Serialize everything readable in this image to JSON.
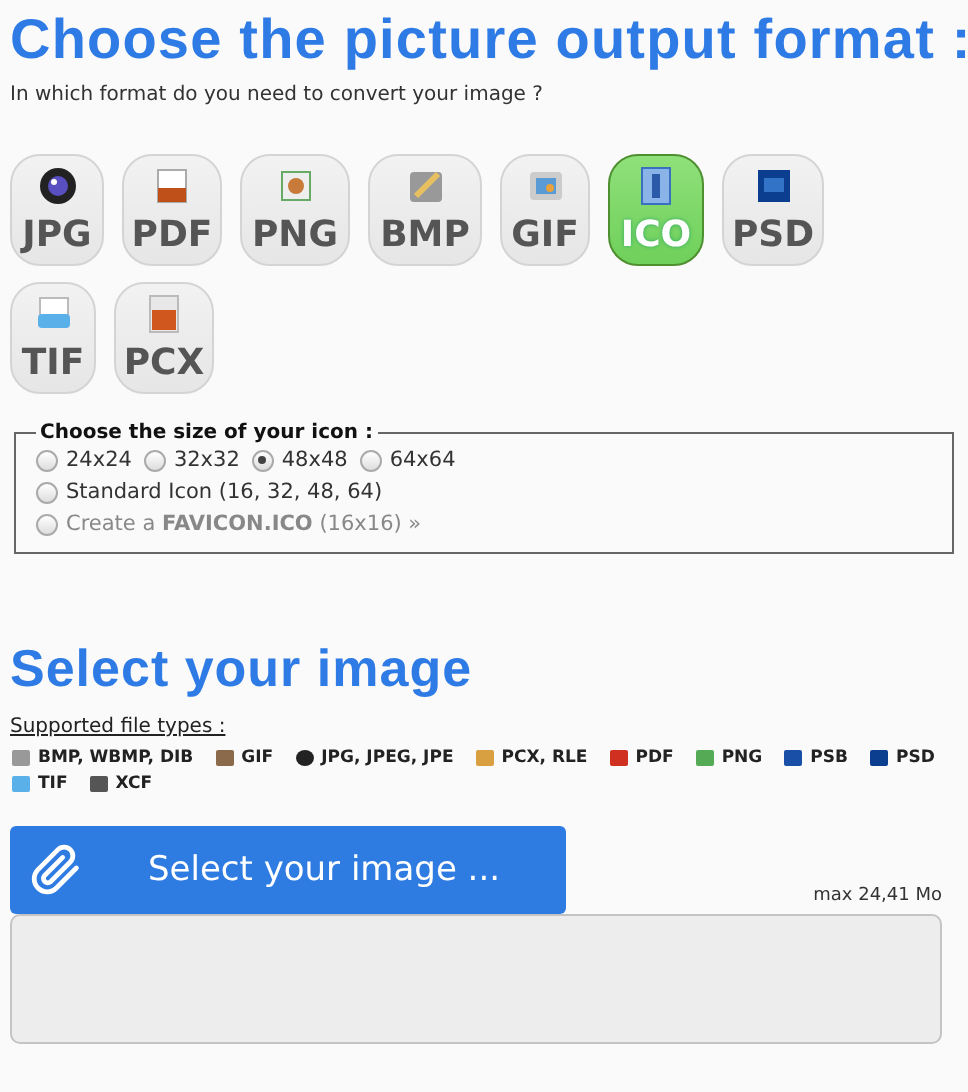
{
  "title": "Choose the picture output format :",
  "subtitle": "In which format do you need to convert your image ?",
  "formats": [
    {
      "label": "JPG",
      "selected": false
    },
    {
      "label": "PDF",
      "selected": false
    },
    {
      "label": "PNG",
      "selected": false
    },
    {
      "label": "BMP",
      "selected": false
    },
    {
      "label": "GIF",
      "selected": false
    },
    {
      "label": "ICO",
      "selected": true
    },
    {
      "label": "PSD",
      "selected": false
    },
    {
      "label": "TIF",
      "selected": false
    },
    {
      "label": "PCX",
      "selected": false
    }
  ],
  "icon_size": {
    "legend": "Choose the size of your icon :",
    "rows": [
      [
        {
          "label": "24x24",
          "selected": false,
          "disabled": false
        },
        {
          "label": "32x32",
          "selected": false,
          "disabled": false
        },
        {
          "label": "48x48",
          "selected": true,
          "disabled": false
        },
        {
          "label": "64x64",
          "selected": false,
          "disabled": false
        }
      ],
      [
        {
          "label": "Standard Icon (16, 32, 48, 64)",
          "selected": false,
          "disabled": false
        }
      ],
      [
        {
          "label": "Create a **FAVICON.ICO** (16x16) »",
          "selected": false,
          "disabled": true
        }
      ]
    ]
  },
  "select": {
    "title": "Select your image",
    "supported_label": "Supported file types :",
    "file_types": [
      "BMP, WBMP, DIB",
      "GIF",
      "JPG, JPEG, JPE",
      "PCX, RLE",
      "PDF",
      "PNG",
      "PSB",
      "PSD",
      "TIF",
      "XCF"
    ],
    "button": "Select your image ...",
    "max_size": "max 24,41 Mo"
  }
}
